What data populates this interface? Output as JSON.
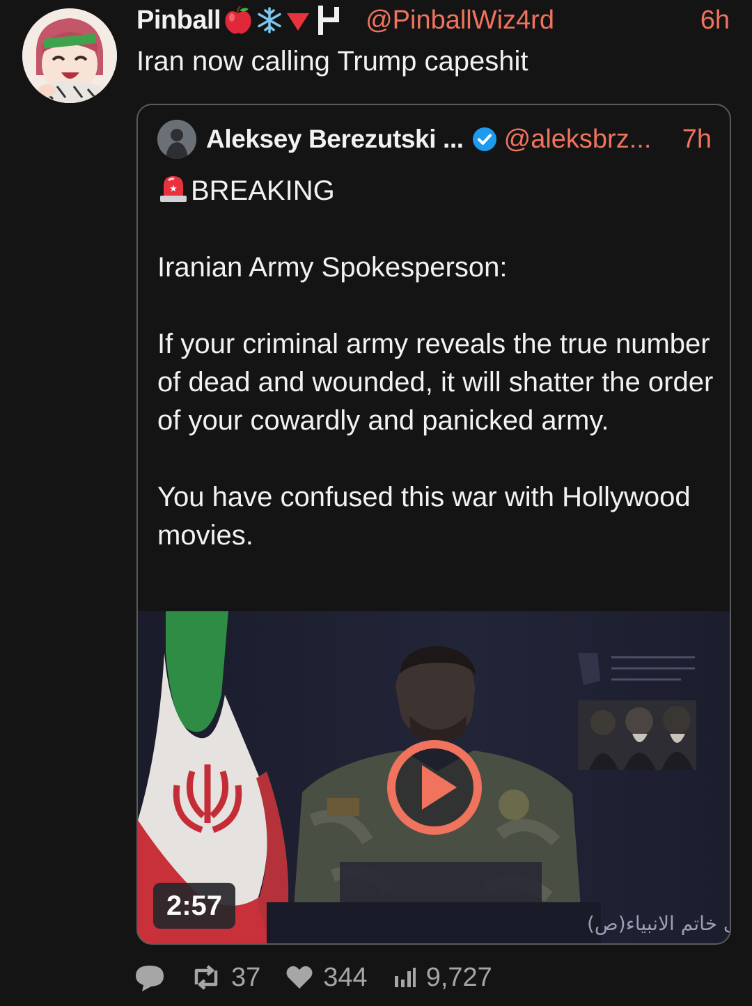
{
  "post": {
    "display_name": "Pinball",
    "name_emojis": [
      "apple-icon",
      "snowflake-icon",
      "red-triangle-icon",
      "flag-icon"
    ],
    "handle": "@PinballWiz4rd",
    "time": "6h",
    "text": "Iran now calling Trump capeshit"
  },
  "quote": {
    "display_name": "Aleksey Berezutski ...",
    "verified": true,
    "handle": "@aleksbrz...",
    "time": "7h",
    "breaking": "BREAKING",
    "paragraphs": [
      "Iranian Army Spokesperson:",
      "If your criminal army reveals the true number of dead and wounded, it will shatter the order of your cowardly and panicked army.",
      "You have confused this war with Hollywood movies."
    ],
    "video": {
      "duration": "2:57",
      "lower_third_text": "قرارگاه مرکزی خاتم الانبیاء(ص)"
    }
  },
  "actions": {
    "reply_count": "",
    "repost_count": "37",
    "like_count": "344",
    "views_count": "9,727"
  },
  "colors": {
    "background": "#141414",
    "accent": "#f0735e",
    "text": "#f2f2f2",
    "muted": "#a6a6a6",
    "border": "#5b5b5b",
    "verified": "#1d9bf0"
  }
}
